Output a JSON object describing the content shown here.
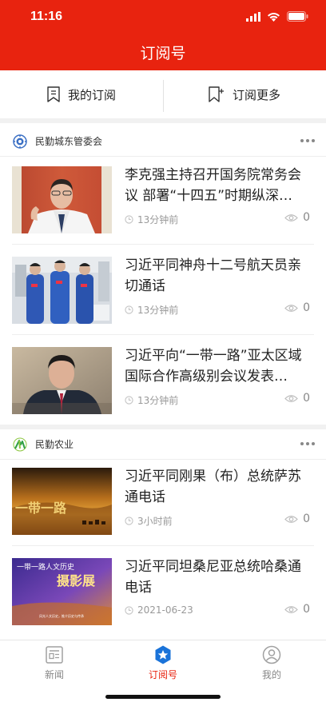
{
  "status_bar": {
    "time": "11:16"
  },
  "header": {
    "title": "订阅号"
  },
  "sub_tabs": [
    {
      "label": "我的订阅",
      "icon": "bookmark-icon"
    },
    {
      "label": "订阅更多",
      "icon": "bookmark-add-icon"
    }
  ],
  "sections": [
    {
      "source": "民勤城东管委会",
      "items": [
        {
          "title": "李克强主持召开国务院常务会议 部署“十四五”时期纵深…",
          "time": "13分钟前",
          "views": "0"
        },
        {
          "title": "习近平同神舟十二号航天员亲切通话",
          "time": "13分钟前",
          "views": "0"
        },
        {
          "title": "习近平向“一带一路”亚太区域国际合作高级别会议发表…",
          "time": "13分钟前",
          "views": "0"
        }
      ]
    },
    {
      "source": "民勤农业",
      "items": [
        {
          "title": "习近平同刚果（布）总统萨苏通电话",
          "time": "3小时前",
          "views": "0",
          "thumb_text": "一带一路"
        },
        {
          "title": "习近平同坦桑尼亚总统哈桑通电话",
          "time": "2021-06-23",
          "views": "0",
          "thumb_text_top": "一带一路人文历史",
          "thumb_text_main": "摄影展",
          "thumb_text_sub": "风光人文历史，推介历史与传承"
        }
      ]
    }
  ],
  "tabbar": [
    {
      "label": "新闻",
      "icon": "news-icon",
      "active": false
    },
    {
      "label": "订阅号",
      "icon": "star-badge-icon",
      "active": true
    },
    {
      "label": "我的",
      "icon": "user-icon",
      "active": false
    }
  ],
  "colors": {
    "brand_red": "#e8230f",
    "muted": "#999999"
  }
}
